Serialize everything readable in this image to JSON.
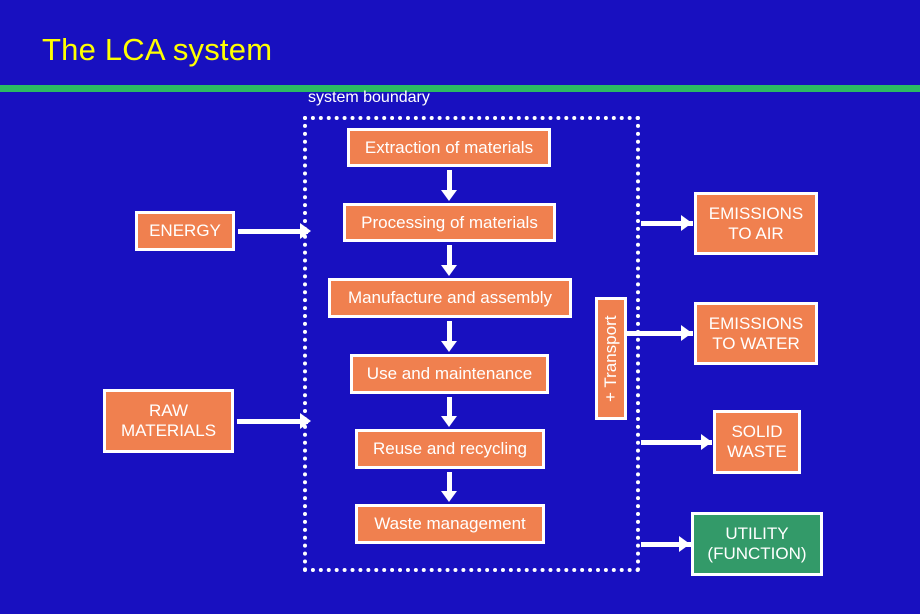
{
  "slide": {
    "title": "The LCA system",
    "title_color": "#ffff00",
    "background_color": "#1810c0",
    "rule_color": "#2cba63"
  },
  "boundary": {
    "label": "system boundary",
    "style": "dotted",
    "color": "#ffffff"
  },
  "colors": {
    "box_fill": "#f0804f",
    "box_fill_green": "#339a69",
    "box_border": "#ffffff",
    "text": "#ffffff"
  },
  "flow": {
    "steps": [
      {
        "label": "Extraction of materials"
      },
      {
        "label": "Processing of materials"
      },
      {
        "label": "Manufacture and assembly"
      },
      {
        "label": "Use and maintenance"
      },
      {
        "label": "Reuse and recycling"
      },
      {
        "label": "Waste management"
      }
    ]
  },
  "inputs": [
    {
      "label": "ENERGY"
    },
    {
      "label": "RAW\nMATERIALS"
    }
  ],
  "transport": {
    "label": "+ Transport"
  },
  "outputs": [
    {
      "label": "EMISSIONS\nTO AIR",
      "color": "#f0804f"
    },
    {
      "label": "EMISSIONS\nTO WATER",
      "color": "#f0804f"
    },
    {
      "label": "SOLID\nWASTE",
      "color": "#f0804f"
    },
    {
      "label": "UTILITY\n(FUNCTION)",
      "color": "#339a69"
    }
  ]
}
